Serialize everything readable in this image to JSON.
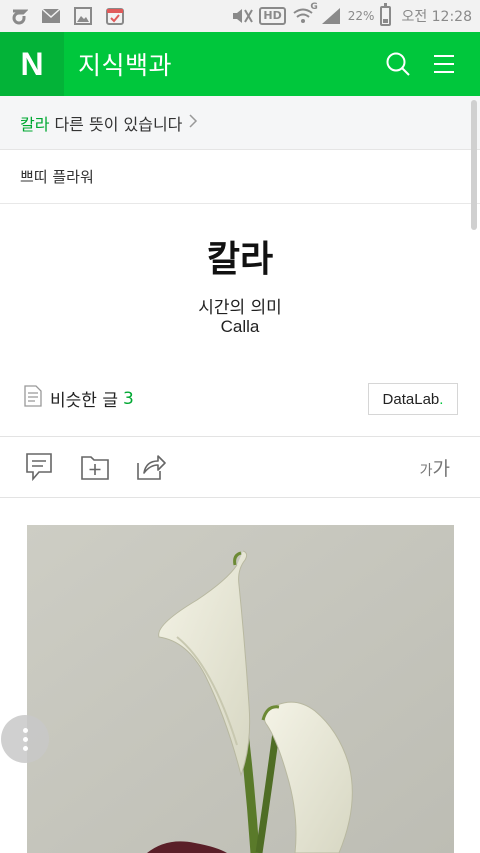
{
  "status_bar": {
    "battery_text": "22%",
    "time": "오전 12:28",
    "hd_label": "HD",
    "network_label": "G",
    "left_icons": [
      "notification-icon",
      "mail-icon",
      "gallery-icon",
      "calendar-icon"
    ]
  },
  "header": {
    "logo": "N",
    "title": "지식백과"
  },
  "notice": {
    "keyword": "칼라",
    "text": "다른 뜻이 있습니다"
  },
  "category": "쁘띠 플라워",
  "entry": {
    "title": "칼라",
    "subtitle": "시간의 의미",
    "subtitle_en": "Calla"
  },
  "similar": {
    "label": "비슷한 글",
    "count": "3"
  },
  "datalab": {
    "label": "DataLab",
    "dot": "."
  },
  "toolbar": {
    "fontsize_small": "가",
    "fontsize_large": "가"
  },
  "colors": {
    "brand_green": "#00c73c",
    "logo_green": "#03b338",
    "accent_text": "#00a832"
  }
}
